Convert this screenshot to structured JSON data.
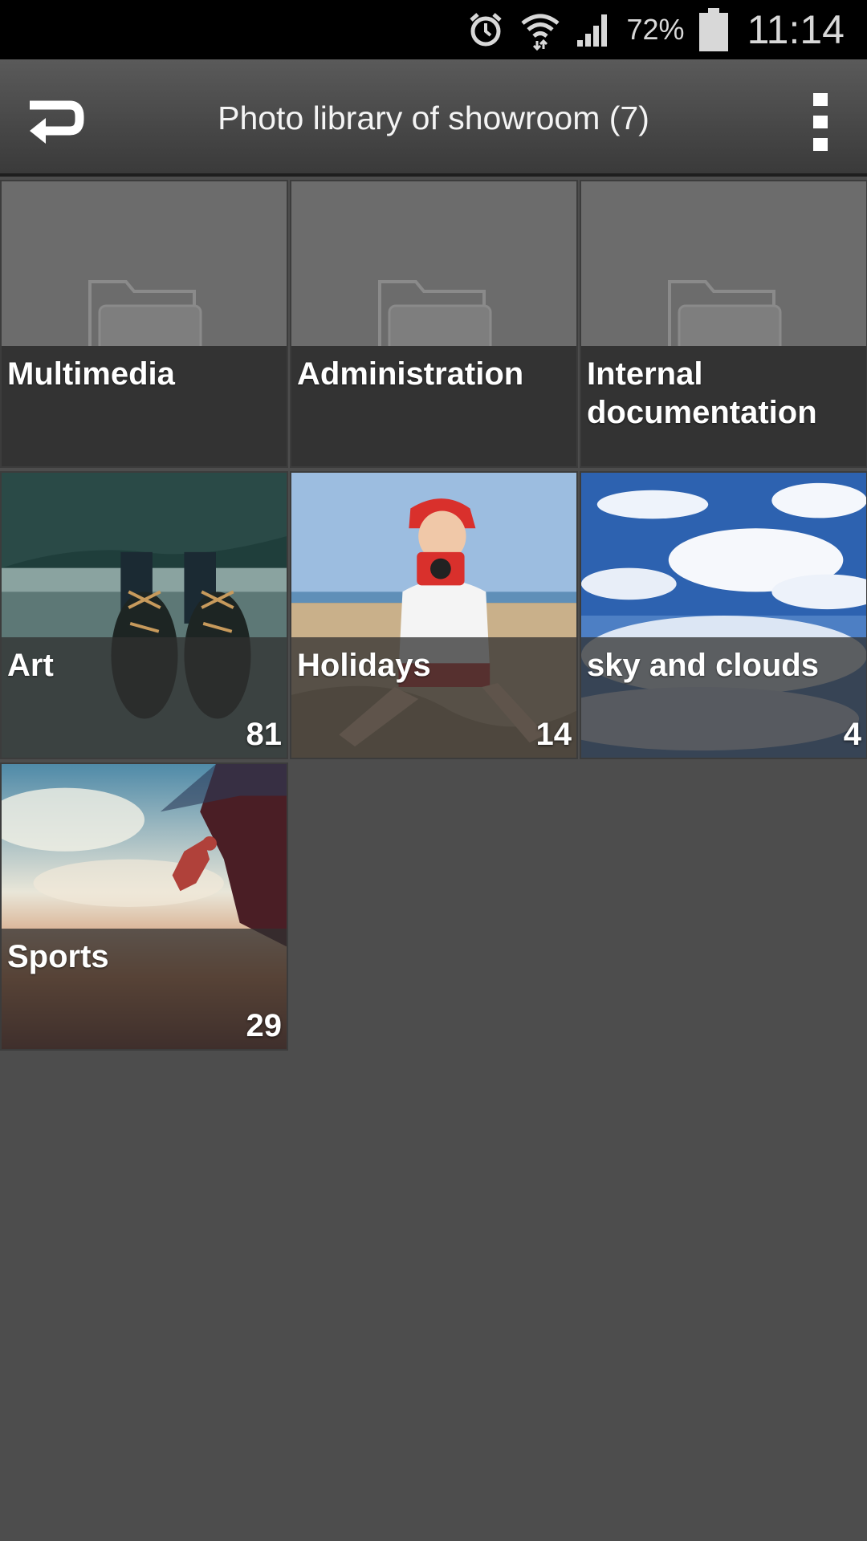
{
  "status_bar": {
    "battery_percent": "72%",
    "time": "11:14",
    "icons": [
      "alarm-icon",
      "wifi-icon",
      "signal-icon",
      "battery-icon"
    ]
  },
  "action_bar": {
    "title": "Photo library of showroom (7)",
    "back_icon": "back-icon",
    "menu_icon": "overflow-menu-icon"
  },
  "albums": [
    {
      "title": "Multimedia",
      "type": "folder",
      "count": ""
    },
    {
      "title": "Administration",
      "type": "folder",
      "count": ""
    },
    {
      "title": "Internal documentation",
      "type": "folder",
      "count": ""
    },
    {
      "title": "Art",
      "type": "photo",
      "count": "81"
    },
    {
      "title": "Holidays",
      "type": "photo",
      "count": "14"
    },
    {
      "title": "sky and clouds",
      "type": "photo",
      "count": "4"
    },
    {
      "title": "Sports",
      "type": "photo",
      "count": "29"
    }
  ],
  "colors": {
    "background": "#4d4d4d",
    "folder_tile": "#6c6c6c",
    "label_band": "#333333"
  }
}
